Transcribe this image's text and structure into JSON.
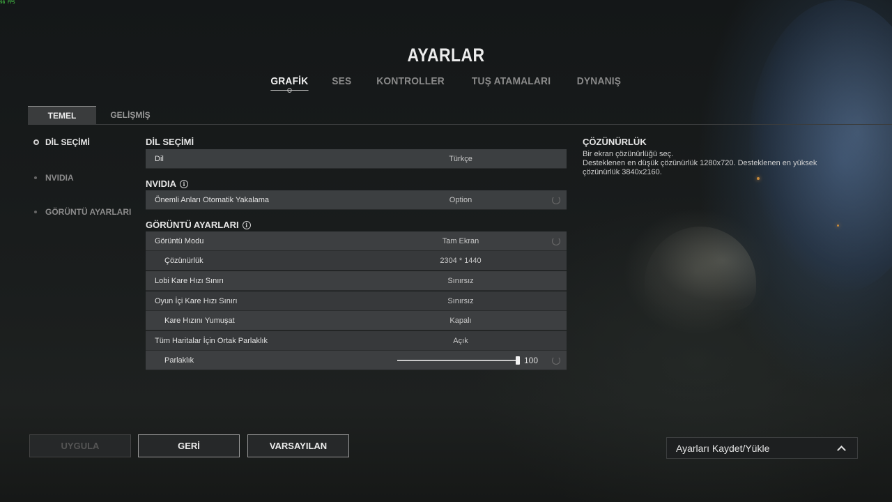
{
  "fps": "98 FPS",
  "title": "AYARLAR",
  "top_tabs": [
    {
      "label": "GRAFİK",
      "active": true
    },
    {
      "label": "SES",
      "active": false
    },
    {
      "label": "KONTROLLER",
      "active": false
    },
    {
      "label": "TUŞ ATAMALARI",
      "active": false
    },
    {
      "label": "DYNANIŞ",
      "active": false
    }
  ],
  "sub_tabs": [
    {
      "label": "TEMEL",
      "active": true
    },
    {
      "label": "GELİŞMİŞ",
      "active": false
    }
  ],
  "sidebar": {
    "items": [
      {
        "label": "DİL SEÇİMİ",
        "active": true
      },
      {
        "label": "NVIDIA",
        "active": false
      },
      {
        "label": "GÖRÜNTÜ AYARLARI",
        "active": false
      }
    ]
  },
  "sections": {
    "language": {
      "heading": "DİL SEÇİMİ",
      "rows": [
        {
          "label": "Dil",
          "value": "Türkçe"
        }
      ]
    },
    "nvidia": {
      "heading": "NVIDIA",
      "rows": [
        {
          "label": "Önemli Anları Otomatik Yakalama",
          "value": "Option"
        }
      ]
    },
    "display": {
      "heading": "GÖRÜNTÜ AYARLARI",
      "rows": [
        {
          "label": "Görüntü Modu",
          "value": "Tam Ekran"
        },
        {
          "label": "Çözünürlük",
          "value": "2304 * 1440"
        },
        {
          "label": "Lobi Kare Hızı Sınırı",
          "value": "Sınırsız"
        },
        {
          "label": "Oyun İçi Kare Hızı Sınırı",
          "value": "Sınırsız"
        },
        {
          "label": "Kare Hızını Yumuşat",
          "value": "Kapalı"
        },
        {
          "label": "Tüm Haritalar İçin Ortak Parlaklık",
          "value": "Açık"
        },
        {
          "label": "Parlaklık",
          "value": "100",
          "slider_fraction": 1.0
        }
      ]
    }
  },
  "info_panel": {
    "heading": "ÇÖZÜNÜRLÜK",
    "line1": "Bir ekran çözünürlüğü seç.",
    "line2": "Desteklenen en düşük çözünürlük 1280x720. Desteklenen en yüksek çözünürlük 3840x2160."
  },
  "buttons": {
    "apply": "UYGULA",
    "back": "GERİ",
    "default": "VARSAYILAN"
  },
  "preset_dropdown": {
    "label": "Ayarları Kaydet/Yükle"
  },
  "colors": {
    "spark": "#c98a3a",
    "fps": "#4ee04e"
  }
}
